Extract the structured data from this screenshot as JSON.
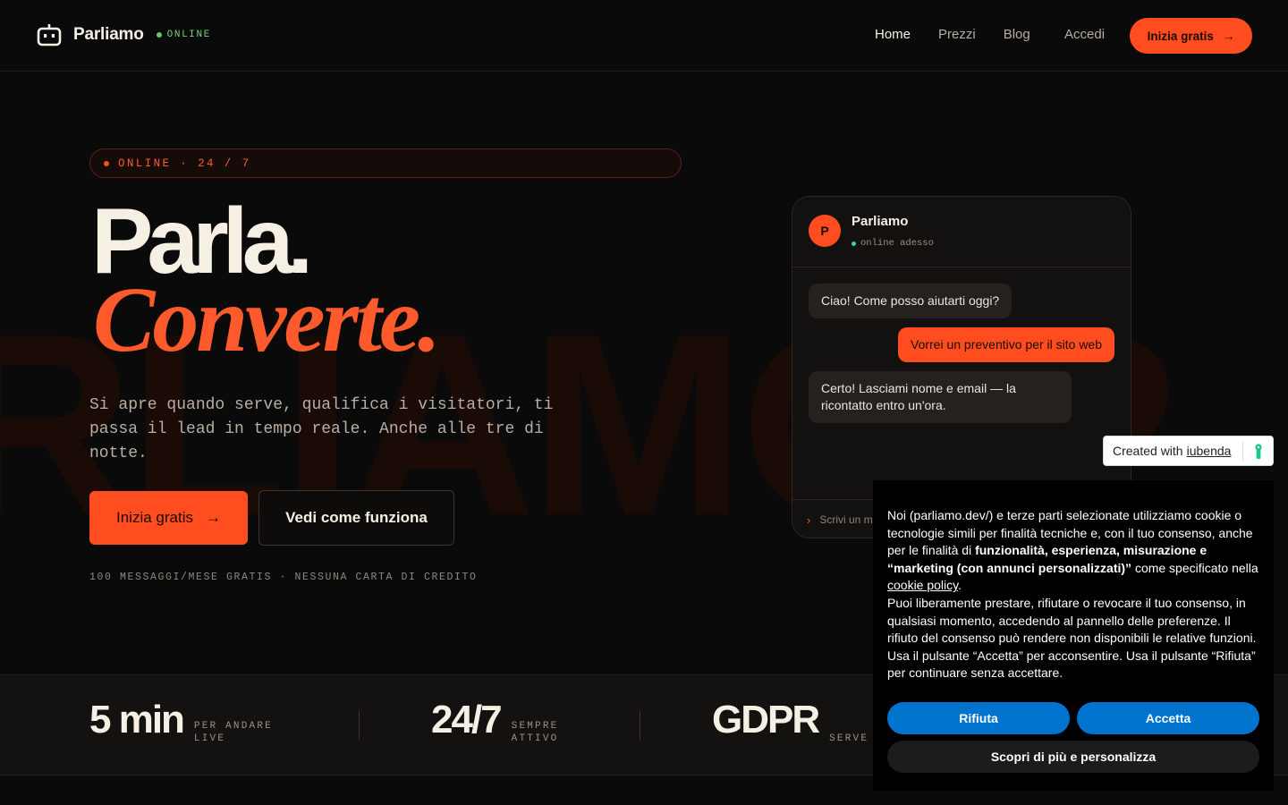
{
  "nav": {
    "brand": "Parliamo",
    "status": "ONLINE",
    "links": [
      "Home",
      "Prezzi",
      "Blog"
    ],
    "login": "Accedi",
    "cta": "Inizia gratis",
    "cta_arrow": "→",
    "icon": "robot-icon",
    "colors": {
      "accent": "#ff4d1f",
      "status_green": "#6cc56c"
    }
  },
  "hero": {
    "pill": "ONLINE · 24 / 7",
    "title_line1": "Parla.",
    "title_line2": "Converte.",
    "lead": "Si apre quando serve, qualifica i visitatori, ti passa il lead in tempo reale. Anche alle tre di notte.",
    "primary_button": "Inizia gratis",
    "primary_arrow": "→",
    "secondary_button": "Vedi come funziona",
    "fineprint": "100 MESSAGGI/MESE GRATIS · NESSUNA CARTA DI CREDITO",
    "background_word": "RLIAMO P"
  },
  "chat": {
    "avatar_letter": "P",
    "name": "Parliamo",
    "status": "online adesso",
    "messages": [
      {
        "from": "bot",
        "text": "Ciao! Come posso aiutarti oggi?"
      },
      {
        "from": "user",
        "text": "Vorrei un preventivo per il sito web"
      },
      {
        "from": "bot",
        "text": "Certo! Lasciami nome e email — la ricontatto entro un'ora."
      }
    ],
    "input_chevron": "›",
    "input_placeholder": "Scrivi un m"
  },
  "stats": [
    {
      "value": "5 min",
      "label": "PER ANDARE LIVE"
    },
    {
      "value": "24/7",
      "label": "SEMPRE ATTIVO"
    },
    {
      "value": "GDPR",
      "label": "SERVE UE"
    }
  ],
  "iubenda": {
    "text": "Created with",
    "link": "iubenda",
    "icon": "iubenda-logo-icon"
  },
  "cookie": {
    "intro": "Noi (parliamo.dev/) e terze parti selezionate utilizziamo cookie o tecnologie simili per finalità tecniche e, con il tuo consenso, anche per le finalità di",
    "bold": "funzionalità, esperienza, misurazione e “marketing (con annunci personalizzati)”",
    "after_bold": "come specificato nella",
    "policy_link": "cookie policy",
    "period": ".",
    "body": "Puoi liberamente prestare, rifiutare o revocare il tuo consenso, in qualsiasi momento, accedendo al pannello delle preferenze. Il rifiuto del consenso può rendere non disponibili le relative funzioni. Usa il pulsante “Accetta” per acconsentire. Usa il pulsante “Rifiuta” per continuare senza accettare.",
    "reject": "Rifiuta",
    "accept": "Accetta",
    "more": "Scopri di più e personalizza",
    "colors": {
      "button_blue": "#0073ce"
    }
  }
}
